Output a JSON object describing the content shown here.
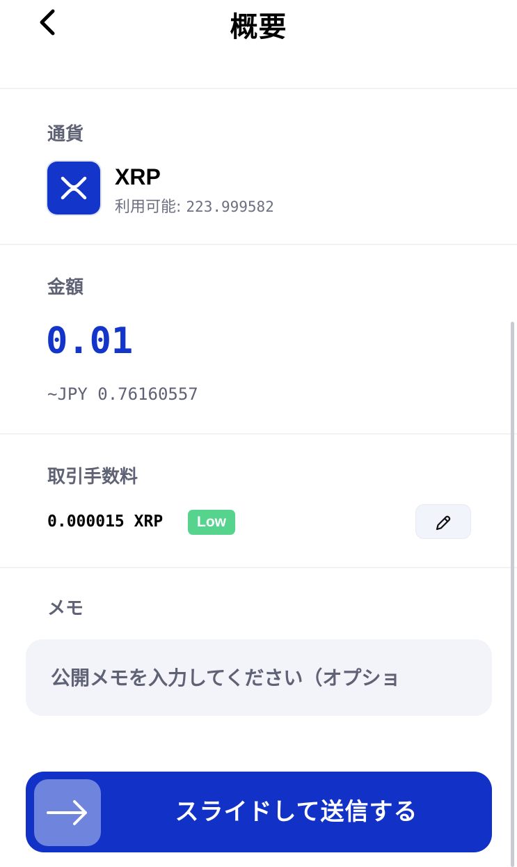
{
  "header": {
    "title": "概要"
  },
  "currency": {
    "label": "通貨",
    "name": "XRP",
    "balance_prefix": "利用可能: ",
    "balance_value": "223.999582",
    "icon": "xrp-logo-icon",
    "icon_color": "#1335c9"
  },
  "amount": {
    "label": "金額",
    "value": "0.01",
    "fiat": "~JPY 0.76160557",
    "accent_color": "#1335c9"
  },
  "fee": {
    "label": "取引手数料",
    "value": "0.000015 XRP",
    "level": "Low",
    "level_color": "#56d38d"
  },
  "memo": {
    "label": "メモ",
    "placeholder": "公開メモを入力してください（オプショ",
    "value": ""
  },
  "send": {
    "label": "スライドして送信する",
    "color": "#1232c7"
  }
}
